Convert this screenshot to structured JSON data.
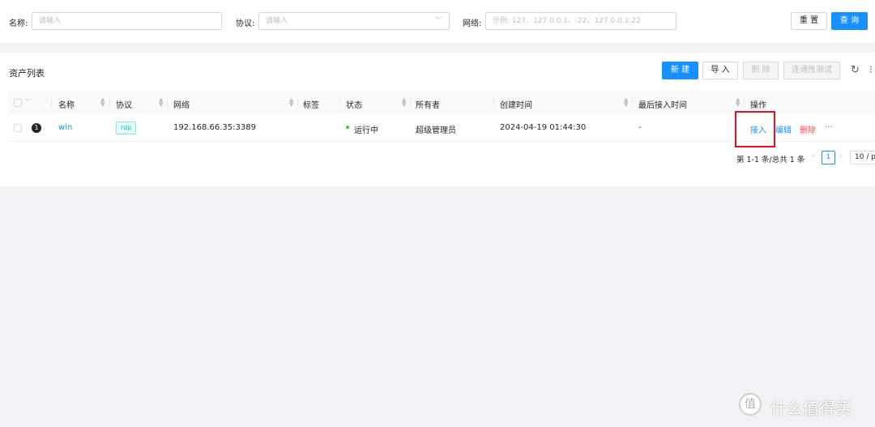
{
  "search": {
    "name_label": "名称:",
    "name_placeholder": "请输入",
    "protocol_label": "协议:",
    "protocol_placeholder": "请输入",
    "network_label": "网络:",
    "network_placeholder": "示例: 127、127.0.0.1、:22、127.0.0.1:22",
    "reset_label": "重 置",
    "query_label": "查 询"
  },
  "list": {
    "title": "资产列表",
    "toolbar": {
      "new_label": "新 建",
      "import_label": "导 入",
      "delete_label": "删 除",
      "test_label": "连通性测试"
    },
    "columns": [
      "名称",
      "协议",
      "网络",
      "标签",
      "状态",
      "所有者",
      "创建时间",
      "最后接入时间",
      "操作"
    ],
    "rows": [
      {
        "index": "1",
        "name": "win",
        "protocol": "rdp",
        "network": "192.168.66.35:3389",
        "tags": "",
        "status": "运行中",
        "owner": "超级管理员",
        "created": "2024-04-19 01:44:30",
        "last_access": "-",
        "actions": {
          "connect": "接入",
          "edit": "编辑",
          "delete": "删除",
          "more": "···"
        }
      }
    ],
    "pagination": {
      "summary": "第 1-1 条/总共 1 条",
      "current": "1",
      "page_size": "10 / p"
    }
  },
  "watermark": {
    "text": "什么值得买"
  },
  "colors": {
    "primary": "#1890ff",
    "danger": "#ff4d4f",
    "success": "#52c41a",
    "highlight": "#e8101f"
  }
}
